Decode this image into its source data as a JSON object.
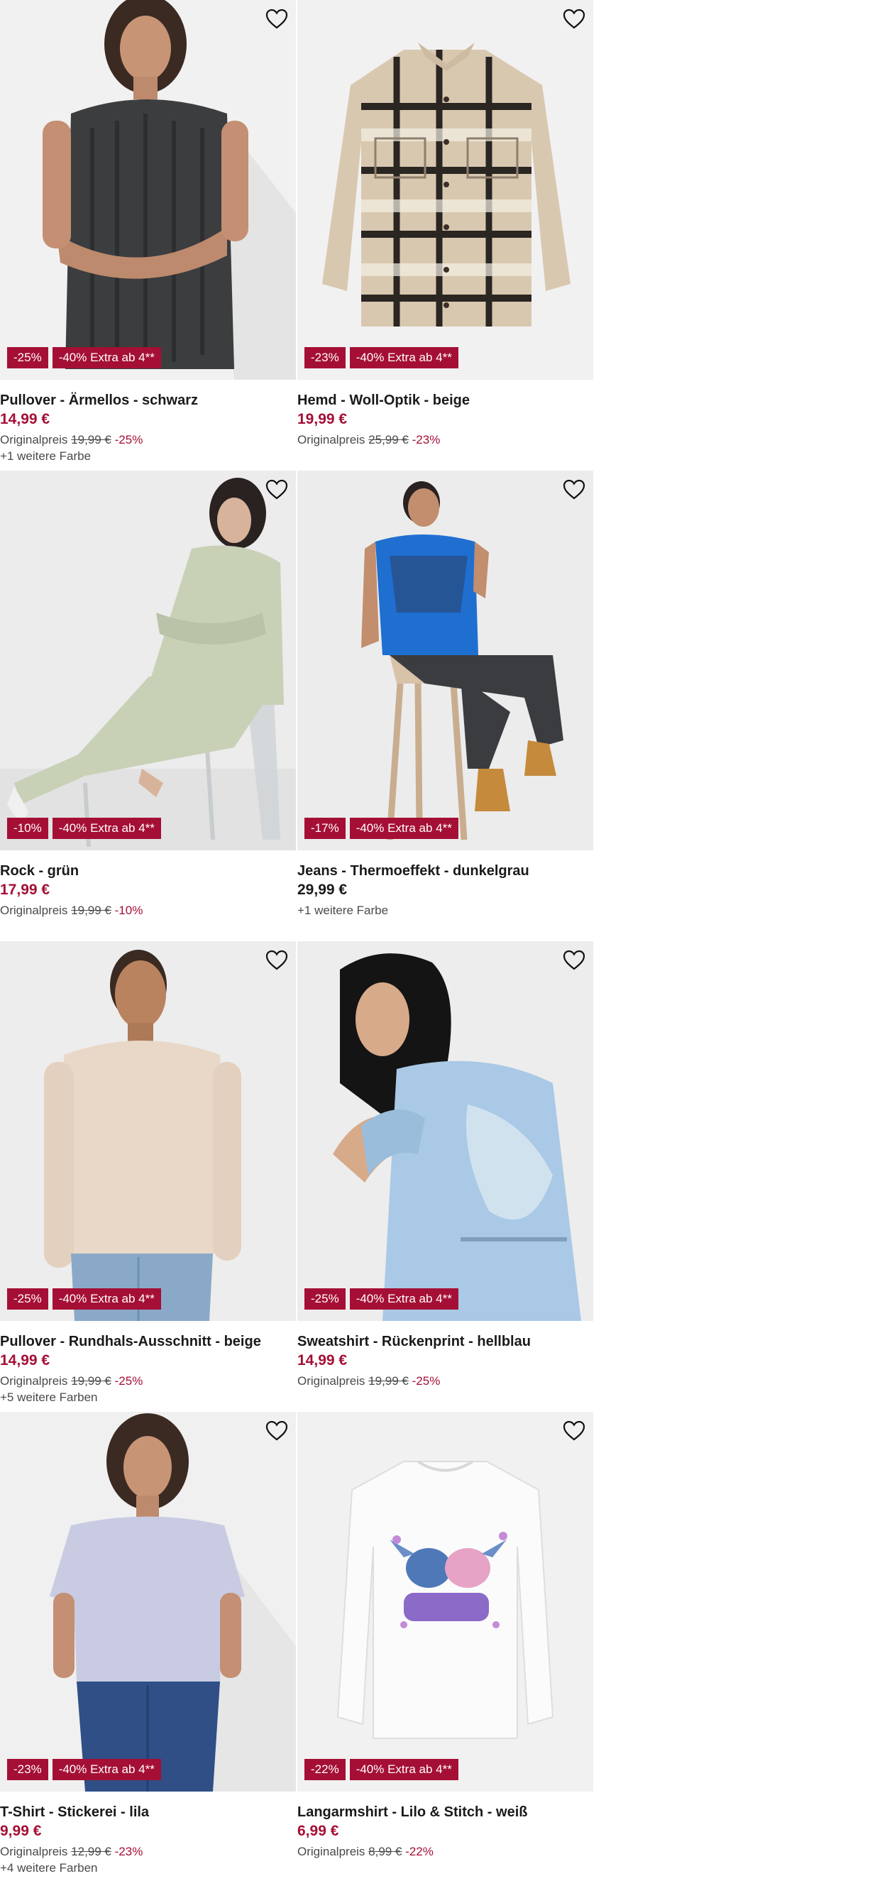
{
  "colors": {
    "accent": "#a50f35",
    "text": "#1a1a1a",
    "muted": "#4a4a4a",
    "image_bg": "#efefef"
  },
  "icons": {
    "wishlist": "heart-outline-icon"
  },
  "products": [
    {
      "title": "Pullover - Ärmellos - schwarz",
      "price": "14,99 €",
      "badge_discount": "-25%",
      "badge_extra": "-40% Extra ab 4**",
      "orig_label": "Originalpreis",
      "orig_price": "19,99 €",
      "orig_pct": "-25%",
      "more_colors": "+1 weitere Farbe"
    },
    {
      "title": "Hemd - Woll-Optik - beige",
      "price": "19,99 €",
      "badge_discount": "-23%",
      "badge_extra": "-40% Extra ab 4**",
      "orig_label": "Originalpreis",
      "orig_price": "25,99 €",
      "orig_pct": "-23%"
    },
    {
      "title": "Rock - grün",
      "price": "17,99 €",
      "badge_discount": "-10%",
      "badge_extra": "-40% Extra ab 4**",
      "orig_label": "Originalpreis",
      "orig_price": "19,99 €",
      "orig_pct": "-10%"
    },
    {
      "title": "Jeans - Thermoeffekt - dunkelgrau",
      "price": "29,99 €",
      "badge_discount": "-17%",
      "badge_extra": "-40% Extra ab 4**",
      "more_colors": "+1 weitere Farbe"
    },
    {
      "title": "Pullover - Rundhals-Ausschnitt - beige",
      "price": "14,99 €",
      "badge_discount": "-25%",
      "badge_extra": "-40% Extra ab 4**",
      "orig_label": "Originalpreis",
      "orig_price": "19,99 €",
      "orig_pct": "-25%",
      "more_colors": "+5 weitere Farben"
    },
    {
      "title": "Sweatshirt - Rückenprint - hellblau",
      "price": "14,99 €",
      "badge_discount": "-25%",
      "badge_extra": "-40% Extra ab 4**",
      "orig_label": "Originalpreis",
      "orig_price": "19,99 €",
      "orig_pct": "-25%"
    },
    {
      "title": "T-Shirt - Stickerei - lila",
      "price": "9,99 €",
      "badge_discount": "-23%",
      "badge_extra": "-40% Extra ab 4**",
      "orig_label": "Originalpreis",
      "orig_price": "12,99 €",
      "orig_pct": "-23%",
      "more_colors": "+4 weitere Farben"
    },
    {
      "title": "Langarmshirt - Lilo & Stitch - weiß",
      "price": "6,99 €",
      "badge_discount": "-22%",
      "badge_extra": "-40% Extra ab 4**",
      "orig_label": "Originalpreis",
      "orig_price": "8,99 €",
      "orig_pct": "-22%"
    }
  ]
}
